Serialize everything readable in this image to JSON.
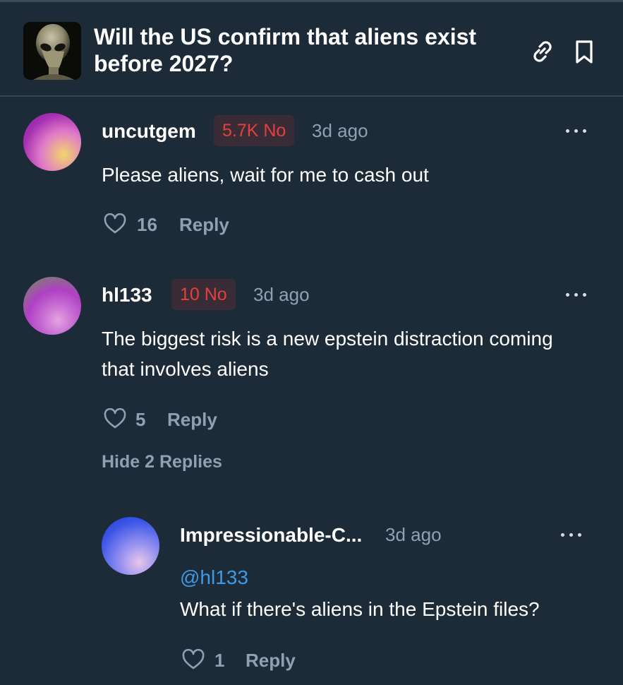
{
  "market": {
    "title": "Will the US confirm that aliens exist before 2027?",
    "thumbnail_icon": "alien-thumbnail",
    "actions": [
      "link-icon",
      "bookmark-icon"
    ]
  },
  "comments": [
    {
      "username": "uncutgem",
      "position": "5.7K No",
      "time": "3d ago",
      "text": "Please aliens, wait for me to cash out",
      "likes": "16",
      "reply_label": "Reply"
    },
    {
      "username": "hl133",
      "position": "10 No",
      "time": "3d ago",
      "text": "The biggest risk is a new epstein distraction coming that involves aliens",
      "likes": "5",
      "reply_label": "Reply",
      "hide_replies_label": "Hide 2 Replies"
    }
  ],
  "replies": [
    {
      "username": "Impressionable-C...",
      "time": "3d ago",
      "mention": "@hl133",
      "text": "What if there's aliens in the Epstein files?",
      "likes": "1",
      "reply_label": "Reply"
    }
  ],
  "colors": {
    "background": "#1d2b39",
    "no_badge_text": "#e4403c",
    "no_badge_bg": "#3a2c36",
    "muted_text": "#8fa0b3",
    "mention": "#3d9ae6"
  }
}
